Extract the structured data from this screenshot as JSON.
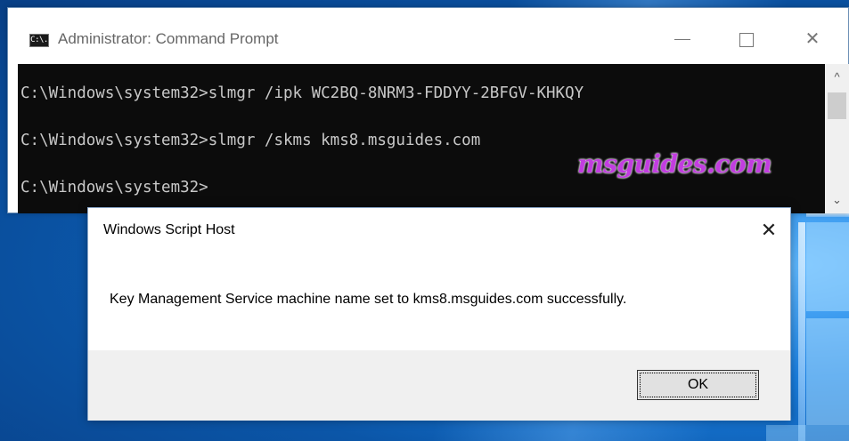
{
  "cmd": {
    "title": "Administrator: Command Prompt",
    "icon_label": "C:\\.",
    "lines": [
      "C:\\Windows\\system32>slmgr /ipk WC2BQ-8NRM3-FDDYY-2BFGV-KHKQY",
      "C:\\Windows\\system32>slmgr /skms kms8.msguides.com",
      "C:\\Windows\\system32>"
    ],
    "controls": {
      "minimize": "—",
      "close": "✕"
    },
    "scroll_up": "^",
    "scroll_down": "⌄"
  },
  "watermark": "msguides.com",
  "dialog": {
    "title": "Windows Script Host",
    "close_glyph": "✕",
    "message": "Key Management Service machine name set to kms8.msguides.com successfully.",
    "ok_label": "OK"
  }
}
